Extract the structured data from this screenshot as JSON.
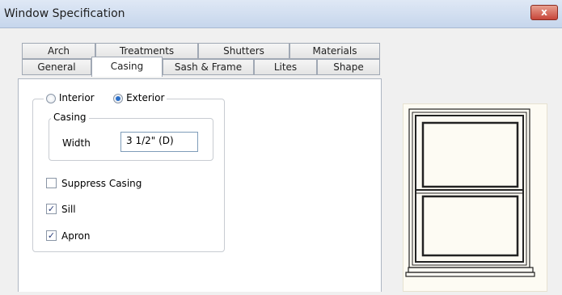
{
  "window": {
    "title": "Window Specification",
    "close_label": "x"
  },
  "tabs_row1": [
    "Arch",
    "Treatments",
    "Shutters",
    "Materials"
  ],
  "tabs_row2": [
    "General",
    "Casing",
    "Sash & Frame",
    "Lites",
    "Shape"
  ],
  "active_tab": "Casing",
  "side": {
    "options": [
      "Interior",
      "Exterior"
    ],
    "selected": "Exterior"
  },
  "casing_group": {
    "label": "Casing",
    "width_label": "Width",
    "width_value": "3 1/2\" (D)"
  },
  "checkboxes": [
    {
      "label": "Suppress Casing",
      "checked": false
    },
    {
      "label": "Sill",
      "checked": true
    },
    {
      "label": "Apron",
      "checked": true
    }
  ]
}
